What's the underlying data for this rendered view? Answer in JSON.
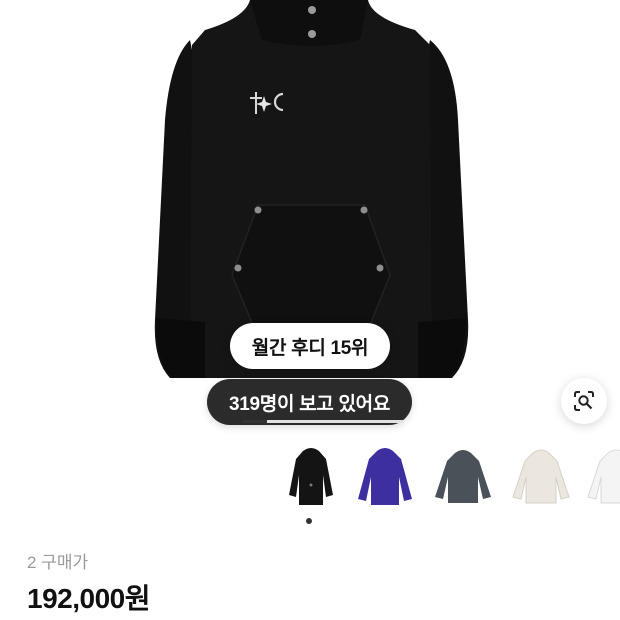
{
  "product": {
    "rank_badge": "월간 후디 15위",
    "viewers_badge": "319명이 보고 있어요",
    "image_progress": 0.15,
    "purchase_count": "2 구매가",
    "price": "192,000원"
  },
  "image_search": {
    "icon": "lens-search-icon"
  },
  "thumbnails": [
    {
      "name": "black hoodie",
      "color": "#141414",
      "selected": true
    },
    {
      "name": "purple hoodie",
      "color": "#3d2fa0"
    },
    {
      "name": "gray hoodie",
      "color": "#4b5158"
    },
    {
      "name": "cream hoodie",
      "color": "#ebe7df"
    },
    {
      "name": "white hoodie",
      "color": "#f4f4f4"
    }
  ]
}
